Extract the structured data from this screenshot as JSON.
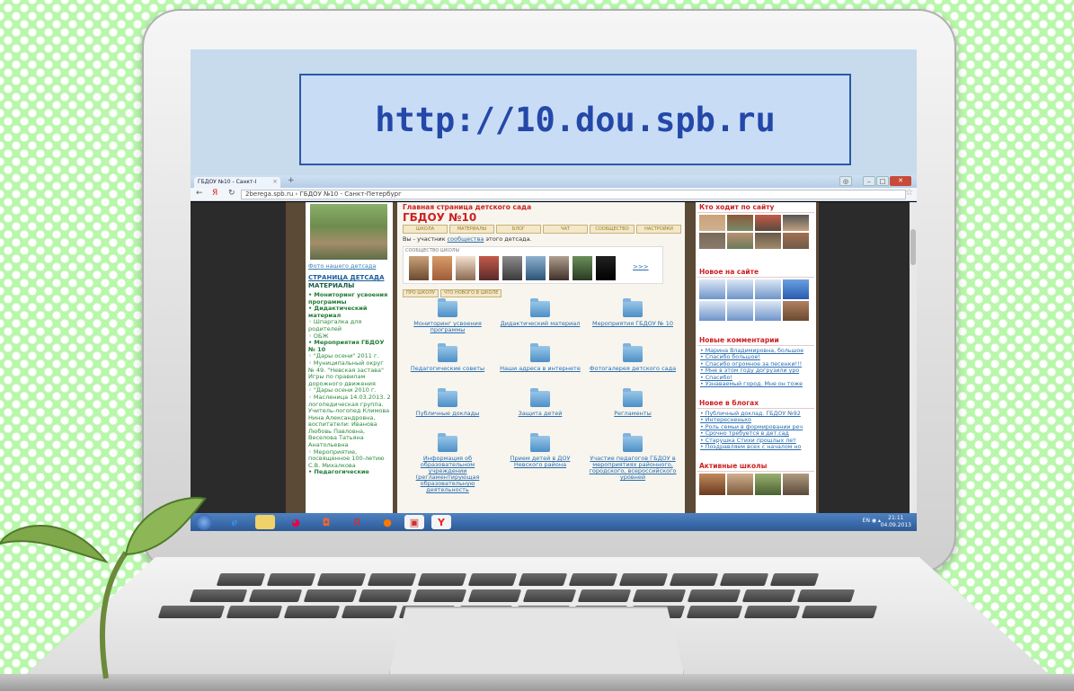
{
  "banner": {
    "url_text": "http://10.dou.spb.ru"
  },
  "browser": {
    "tab_title": "ГБДОУ №10 - Санкт-I",
    "address": "2berega.spb.ru › ГБДОУ №10 - Санкт-Петербург",
    "back_icon": "←",
    "yandex_icon": "Я",
    "reload_icon": "↻"
  },
  "left": {
    "photo_caption": "Фото нашего детсада",
    "section_title": "СТРАНИЦА ДЕТСАДА",
    "materials": "МАТЕРИАЛЫ",
    "items": [
      {
        "text": "• Мониторинг усвоения программы",
        "bold": true
      },
      {
        "text": "• Дидактический материал",
        "bold": true
      },
      {
        "text": "  ◦ Шпаргалка для родителей",
        "bold": false
      },
      {
        "text": "  ◦ ОБЖ",
        "bold": false
      },
      {
        "text": "• Мероприятия ГБДОУ № 10",
        "bold": true
      },
      {
        "text": "  ◦ \"Дары осени\" 2011 г.",
        "bold": false
      },
      {
        "text": "  ◦ Муниципальный округ № 49. \"Невская застава\" Игры по правилам дорожного движения",
        "bold": false
      },
      {
        "text": "  ◦ \"Дары осени 2010 г.",
        "bold": false
      },
      {
        "text": "  ◦ Масленица 14.03.2013. 2 логопедическая группа. Учитель-логопед Климова Нина Александровна, воспитатели: Иванова Любовь Павловна, Веселова Татьяна Анатольевна",
        "bold": false
      },
      {
        "text": "  ◦ Мероприятие, посвященное 100-летию С.В. Михалкова",
        "bold": false
      },
      {
        "text": "• Педагогические",
        "bold": true
      }
    ]
  },
  "center": {
    "page_title": "Главная страница детского сада",
    "org_name": "ГБДОУ №10",
    "tabs": [
      "ШКОЛА",
      "МАТЕРИАЛЫ",
      "БЛОГ",
      "ЧАТ",
      "СООБЩЕСТВО",
      "НАСТРОЙКИ"
    ],
    "member_prefix": "Вы - участник ",
    "member_link": "сообщества",
    "member_suffix": " этого детсада.",
    "community_label": "СООБЩЕСТВО ШКОЛЫ",
    "more_link": ">>>",
    "subtabs": [
      "ПРО ШКОЛУ",
      "ЧТО НОВОГО В ШКОЛЕ"
    ],
    "folders": [
      "Мониторинг усвоения программы",
      "Дидактический материал",
      "Мероприятия ГБДОУ № 10",
      "Педагогические советы",
      "Наши адреса в интернете",
      "Фотогалерея детского сада",
      "Публичные доклады",
      "Защита детей",
      "Регламенты",
      "Информация об образовательном учреждении (регламентирующая образовательную деятельность",
      "Прием детей в ДОУ Невского района",
      "Участие педагогов ГБДОУ в мероприятиях районного, городского, всероссийского уровней"
    ]
  },
  "right": {
    "visitors_title": "Кто ходит по сайту",
    "new_title": "Новое на сайте",
    "comments_title": "Новые комментарии",
    "comments": [
      "• Марина Владимировна, большое",
      "• Спасибо большое!",
      "• Спасибо огромное за песенки!!!",
      "• Мне в этом году догрузили уро",
      "• Спасибо!",
      "• Узнаваемый город. Мне он тоже"
    ],
    "blogs_title": "Новое в блогах",
    "blogs": [
      "• Публичный доклад. ГБДОУ №92",
      "• Интересненько",
      "• Роль семьи в формировании реч",
      "• Срочно требуется в дет.сад",
      "• Старушка Стихи прошлых лет",
      "• Поздравляем всех с началом но"
    ],
    "schools_title": "Активные школы"
  },
  "taskbar": {
    "lang": "EN",
    "time": "21:11",
    "date": "04.09.2013",
    "icons": [
      "start-orb-icon",
      "ie-icon",
      "explorer-icon",
      "media-icon",
      "opera-icon",
      "yandex-icon",
      "firefox-icon",
      "gallery-icon",
      "yandex-browser-icon"
    ]
  }
}
